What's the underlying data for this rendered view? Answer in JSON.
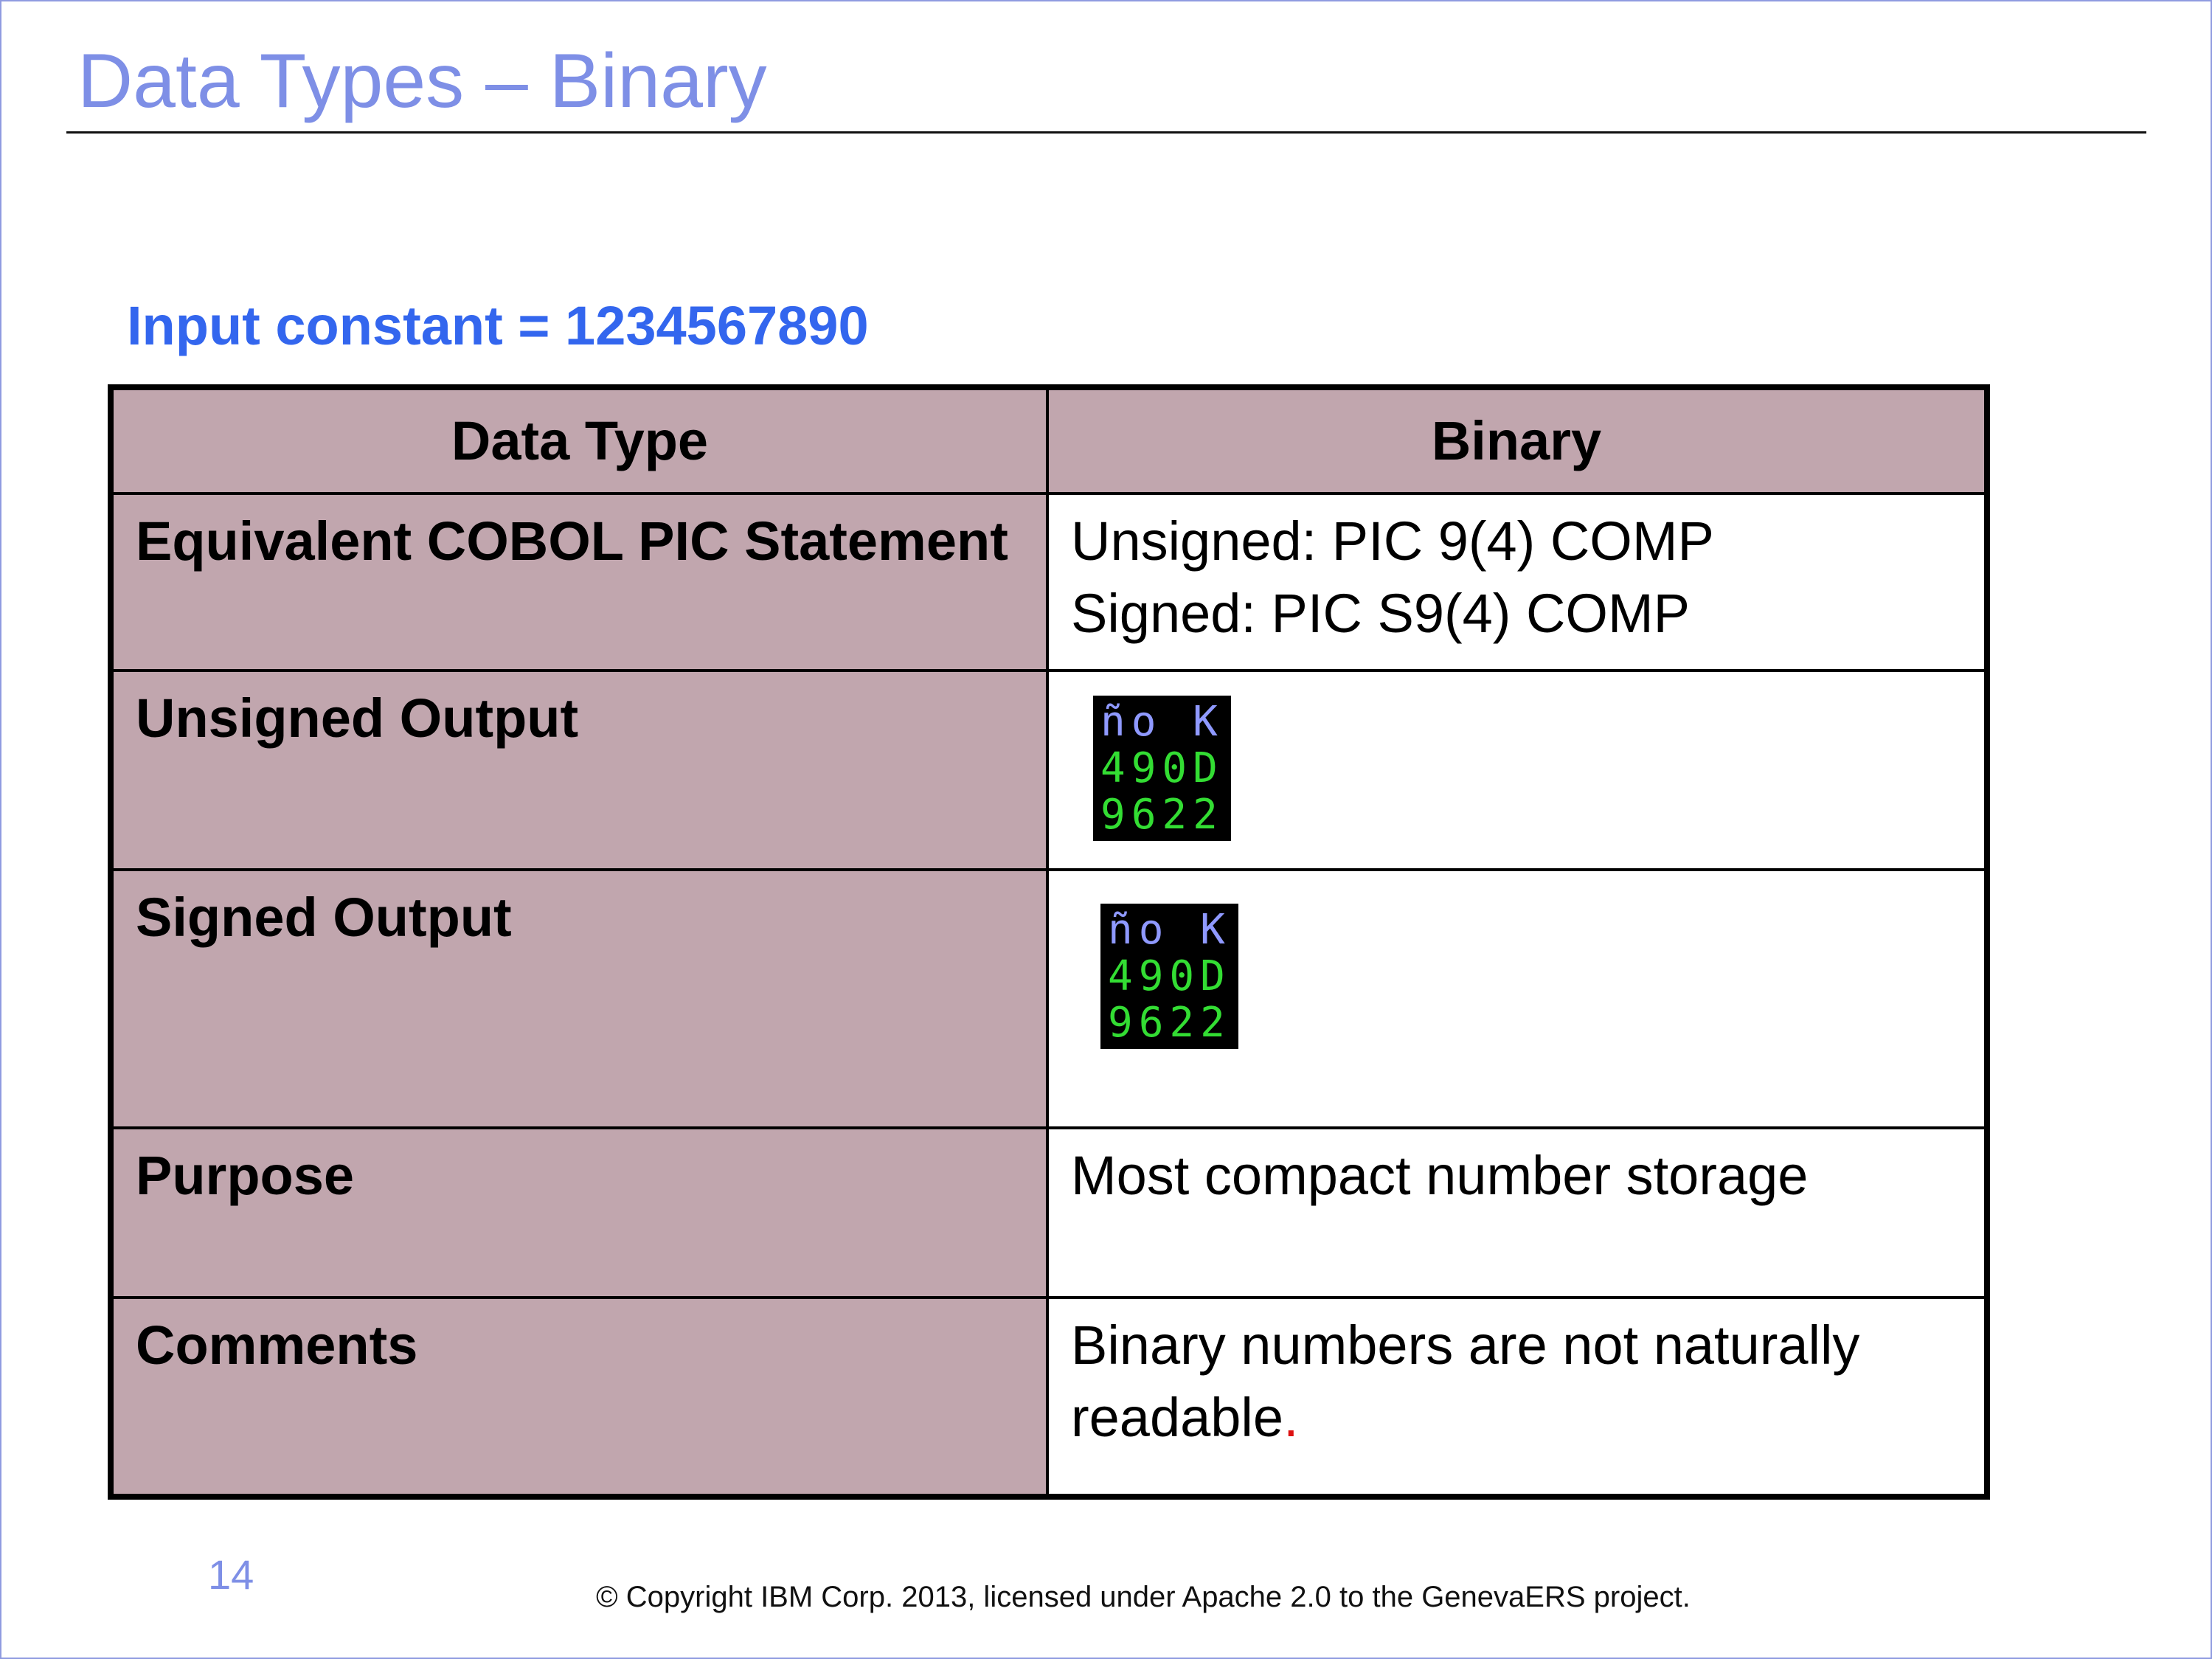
{
  "slide": {
    "title": "Data Types – Binary",
    "subtitle": "Input constant = 1234567890",
    "page_number": "14",
    "copyright": "© Copyright IBM Corp. 2013, licensed under Apache 2.0 to the GenevaERS project."
  },
  "table": {
    "headers": [
      "Data Type",
      "Binary"
    ],
    "rows": {
      "cobol": {
        "label": "Equivalent COBOL PIC Statement",
        "line1": "Unsigned: PIC 9(4) COMP",
        "line2": "Signed: PIC S9(4) COMP"
      },
      "unsigned": {
        "label": "Unsigned Output",
        "terminal": [
          "ño K",
          "490D",
          "9622"
        ]
      },
      "signed": {
        "label": "Signed Output",
        "terminal": [
          "ño K",
          "490D",
          "9622"
        ]
      },
      "purpose": {
        "label": "Purpose",
        "value": "Most compact number storage"
      },
      "comments": {
        "label": "Comments",
        "value": "Binary numbers are not naturally readable",
        "value_end": "."
      }
    }
  },
  "colors": {
    "title": "#7e8fe6",
    "subtitle": "#3366ee",
    "label_bg": "#c1a6ae",
    "terminal_top": "#8f99ff",
    "terminal_digits": "#33dd33"
  }
}
